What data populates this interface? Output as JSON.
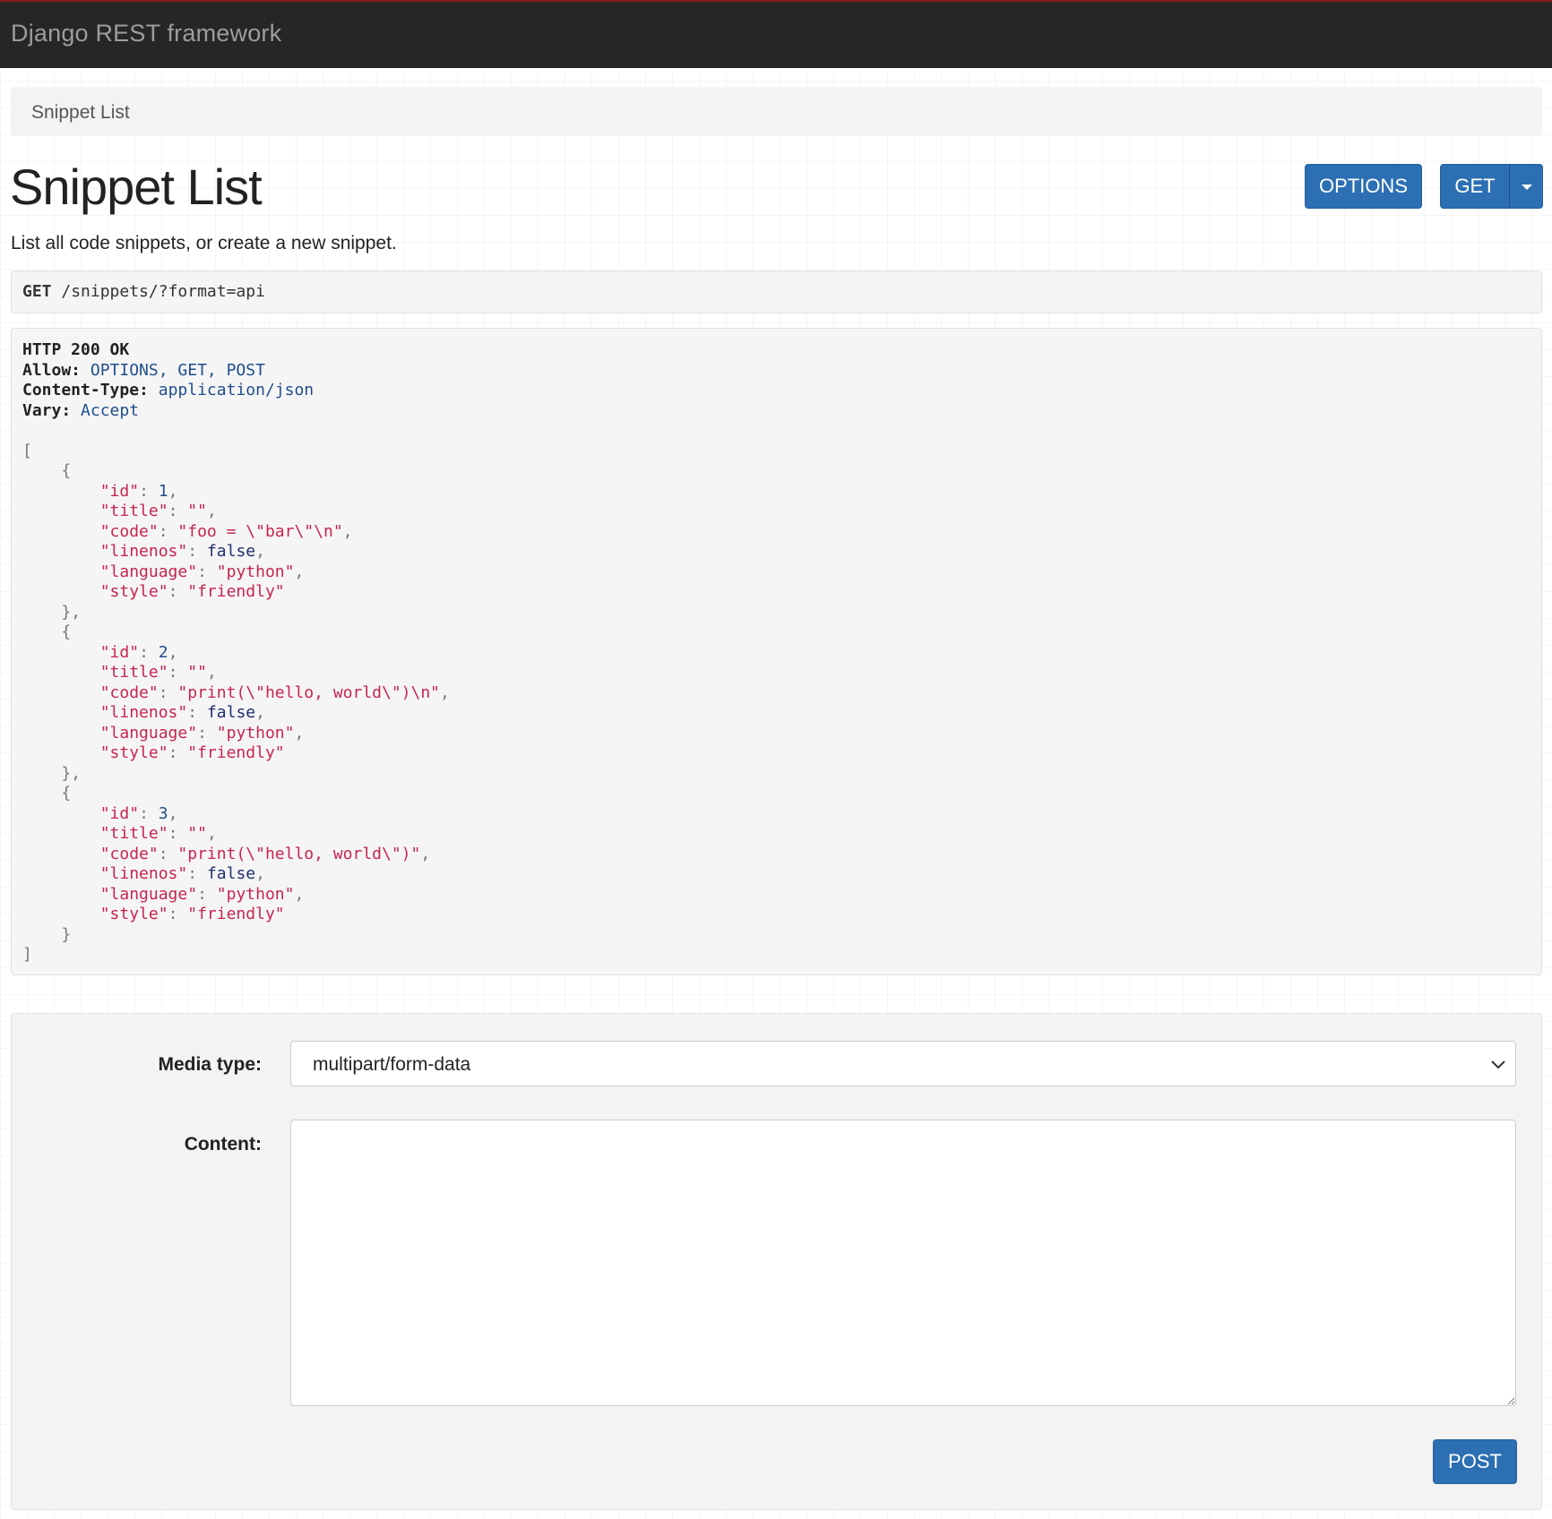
{
  "navbar": {
    "brand": "Django REST framework",
    "colors": {
      "background": "#262626",
      "accent_border": "#8a1c1c",
      "brand_text": "#9d9d9d"
    }
  },
  "breadcrumb": {
    "items": [
      "Snippet List"
    ]
  },
  "header": {
    "title": "Snippet List",
    "options_button": "OPTIONS",
    "get_button": "GET",
    "button_color": "#2c6fb3",
    "toggle_icon": "caret-down-icon"
  },
  "description": "List all code snippets, or create a new snippet.",
  "request": {
    "method": "GET",
    "url_path": "/snippets/",
    "url_query": "?format=api"
  },
  "response": {
    "status": "HTTP 200 OK",
    "headers": [
      {
        "key": "Allow:",
        "value": "OPTIONS, GET, POST"
      },
      {
        "key": "Content-Type:",
        "value": "application/json"
      },
      {
        "key": "Vary:",
        "value": "Accept"
      }
    ],
    "snippets": [
      {
        "id": "1",
        "title": "\"\"",
        "code": "\"foo = \\\"bar\\\"\\n\"",
        "linenos": "false",
        "language": "\"python\"",
        "style": "\"friendly\""
      },
      {
        "id": "2",
        "title": "\"\"",
        "code": "\"print(\\\"hello, world\\\")\\n\"",
        "linenos": "false",
        "language": "\"python\"",
        "style": "\"friendly\""
      },
      {
        "id": "3",
        "title": "\"\"",
        "code": "\"print(\\\"hello, world\\\")\"",
        "linenos": "false",
        "language": "\"python\"",
        "style": "\"friendly\""
      }
    ],
    "key_labels": {
      "id": "\"id\"",
      "title": "\"title\"",
      "code": "\"code\"",
      "linenos": "\"linenos\"",
      "language": "\"language\"",
      "style": "\"style\""
    }
  },
  "form": {
    "media_type_label": "Media type:",
    "media_type_value": "multipart/form-data",
    "media_type_options": [
      "multipart/form-data"
    ],
    "content_label": "Content:",
    "content_value": "",
    "post_button": "POST",
    "select_icon": "chevron-down-icon"
  }
}
